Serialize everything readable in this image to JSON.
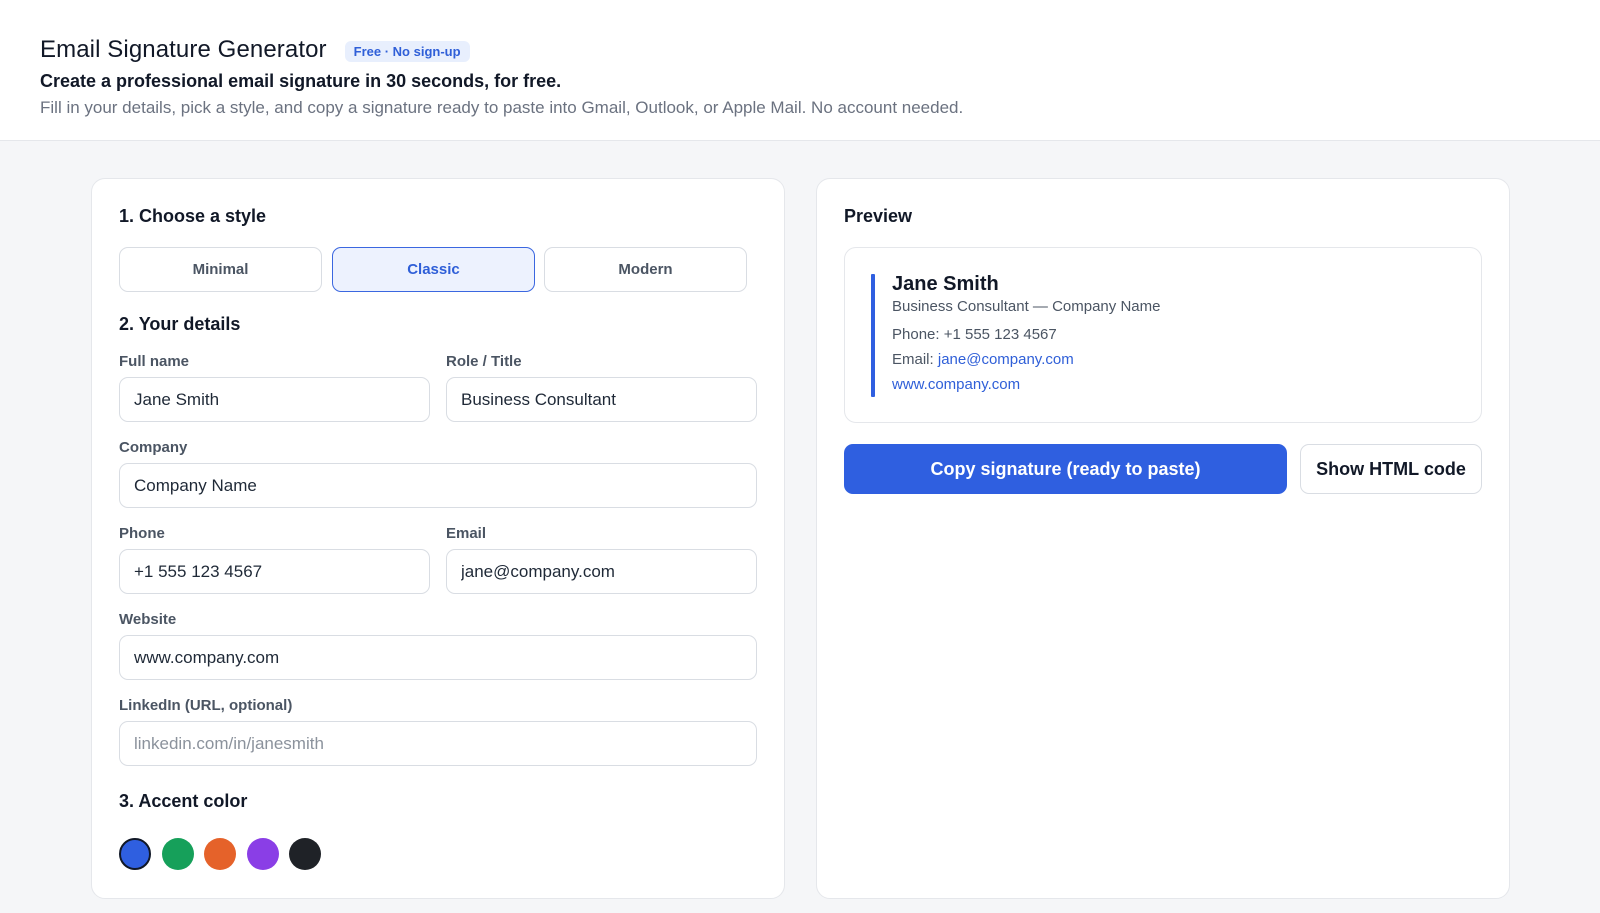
{
  "header": {
    "title": "Email Signature Generator",
    "badge": "Free · No sign-up",
    "tagline": "Create a professional email signature in 30 seconds, for free.",
    "subtext": "Fill in your details, pick a style, and copy a signature ready to paste into Gmail, Outlook, or Apple Mail. No account needed."
  },
  "form": {
    "style_section": "1. Choose a style",
    "styles": [
      {
        "label": "Minimal",
        "selected": false
      },
      {
        "label": "Classic",
        "selected": true
      },
      {
        "label": "Modern",
        "selected": false
      }
    ],
    "details_section": "2. Your details",
    "fields": {
      "full_name": {
        "label": "Full name",
        "value": "Jane Smith"
      },
      "role": {
        "label": "Role / Title",
        "value": "Business Consultant"
      },
      "company": {
        "label": "Company",
        "value": "Company Name"
      },
      "phone": {
        "label": "Phone",
        "value": "+1 555 123 4567"
      },
      "email": {
        "label": "Email",
        "value": "jane@company.com"
      },
      "website": {
        "label": "Website",
        "value": "www.company.com"
      },
      "linkedin": {
        "label": "LinkedIn (URL, optional)",
        "value": "",
        "placeholder": "linkedin.com/in/janesmith"
      }
    },
    "accent_section": "3. Accent color",
    "accent_colors": [
      {
        "name": "blue",
        "hex": "#2f5fe0",
        "selected": true
      },
      {
        "name": "green",
        "hex": "#16a05a",
        "selected": false
      },
      {
        "name": "orange",
        "hex": "#e5622a",
        "selected": false
      },
      {
        "name": "purple",
        "hex": "#8a3ee6",
        "selected": false
      },
      {
        "name": "black",
        "hex": "#1f2227",
        "selected": false
      }
    ]
  },
  "preview": {
    "title": "Preview",
    "name": "Jane Smith",
    "role_line": "Business Consultant — Company Name",
    "phone_label": "Phone:",
    "phone": "+1 555 123 4567",
    "email_label": "Email:",
    "email": "jane@company.com",
    "website": "www.company.com",
    "copy_button": "Copy signature (ready to paste)",
    "html_button": "Show HTML code"
  }
}
